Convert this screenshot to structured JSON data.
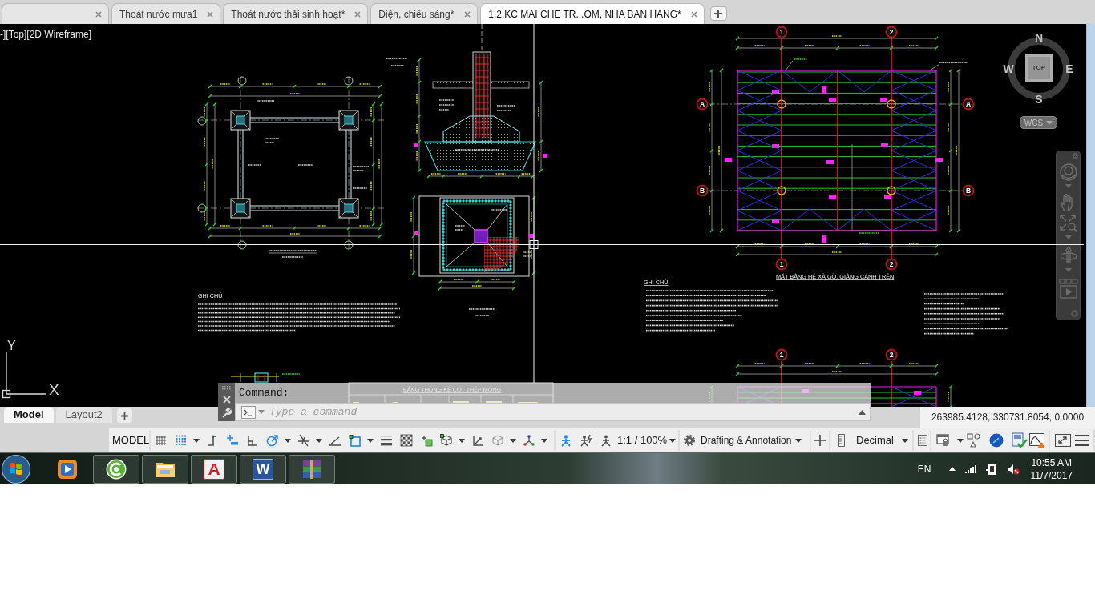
{
  "document_tabs": [
    {
      "selected": false
    },
    {
      "label": "Thoát nước mưa1",
      "selected": false
    },
    {
      "label": "Thoát nước thải sinh hoạt*",
      "selected": false
    },
    {
      "label": "Điện, chiếu sáng*",
      "selected": false
    },
    {
      "label": "1,2.KC MAI CHE TR...OM, NHA BAN HANG*",
      "selected": true
    }
  ],
  "viewport": {
    "label": "-][Top][2D Wireframe]"
  },
  "drawing": {
    "plan_title": "MẶT BẰNG HỆ XÀ GỒ, GIẰNG CÁNH TRÊN",
    "notes_headings": [
      "GHI CHÚ",
      "GHI CHÚ"
    ],
    "table_title": "BẢNG THỐNG KÊ CỐT THÉP MÓNG",
    "grid_bubbles": [
      "1",
      "2",
      "A",
      "B",
      "A",
      "B",
      "1",
      "2",
      "1",
      "2"
    ]
  },
  "viewcube": {
    "north": "N",
    "west": "W",
    "east": "E",
    "south": "S",
    "face": "TOP",
    "coordinate_system": "WCS"
  },
  "ucs_icon": {
    "y_label": "Y",
    "x_label": "X"
  },
  "command_line": {
    "history": "Command:",
    "placeholder": "Type a command"
  },
  "layout_tabs": [
    {
      "label": "Model",
      "selected": true
    },
    {
      "label": "Layout2",
      "selected": false
    }
  ],
  "coordinates": "263985.4128, 330731.8054, 0.0000",
  "status_bar": {
    "space": "MODEL",
    "tools": [
      {
        "on": false
      },
      {
        "on": true
      },
      {
        "on": false
      },
      {
        "on": true
      },
      {
        "on": false
      },
      {
        "on": true
      },
      {
        "on": false
      },
      {
        "on": false
      },
      {
        "on": true
      },
      {
        "on": false
      },
      {
        "on": false
      },
      {
        "on": false
      },
      {
        "on": false
      },
      {
        "on": false
      },
      {
        "on": false
      },
      {
        "on": false
      },
      {
        "on": true
      },
      {
        "on": false
      },
      {
        "on": false
      }
    ],
    "annotation_scale": "1:1 / 100%",
    "workspace": "Drafting & Annotation",
    "units": "Decimal",
    "hardware_acceleration": {
      "on": true
    }
  },
  "taskbar": {
    "apps": [
      {
        "running": false
      },
      {
        "running": true
      },
      {
        "running": true
      },
      {
        "running": true,
        "glyph": "A"
      },
      {
        "running": true,
        "glyph": "W"
      },
      {
        "running": true
      }
    ],
    "language": "EN",
    "time": "10:55 AM",
    "date": "11/7/2017"
  }
}
